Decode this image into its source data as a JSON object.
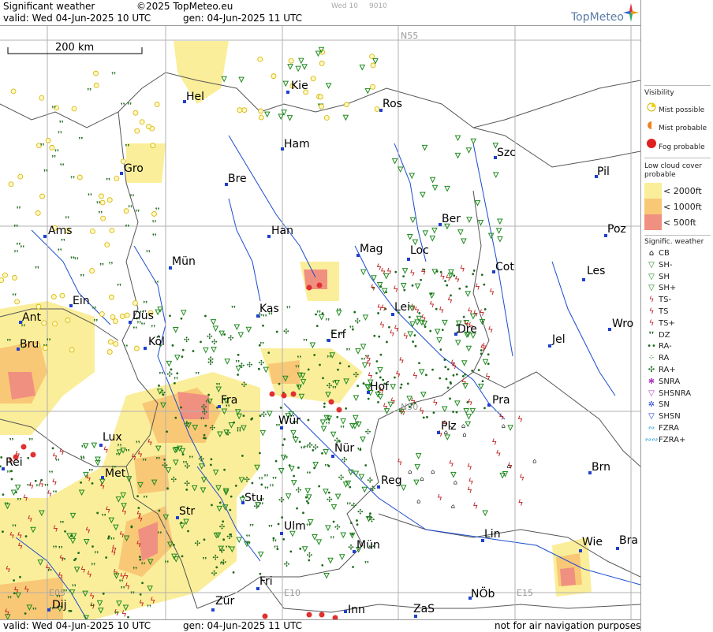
{
  "header": {
    "title": "Significant weather",
    "copyright": "©2025 TopMeteo.eu",
    "valid": "valid:  Wed  04-Jun-2025  10 UTC",
    "gen": "gen: 04-Jun-2025 11 UTC",
    "faint1": "Wed 10",
    "faint2": "9010",
    "logo": "TopMeteo"
  },
  "scale": {
    "label": "200 km"
  },
  "footer": {
    "valid": "valid:  Wed  04-Jun-2025  10 UTC",
    "gen": "gen: 04-Jun-2025 11 UTC",
    "note": "not for air navigation purposes"
  },
  "grid_labels": {
    "n55": "N55",
    "n50": "N50",
    "e05": "E05",
    "e10": "E10",
    "e15": "E15"
  },
  "cities": [
    "Kie",
    "Hel",
    "Ros",
    "Ham",
    "Szc",
    "Gro",
    "Bre",
    "Pil",
    "Ber",
    "Ams",
    "Han",
    "Poz",
    "Mag",
    "Loc",
    "Mün",
    "Cot",
    "Les",
    "Ein",
    "Kas",
    "Lei",
    "Ant",
    "Düs",
    "Wro",
    "Dre",
    "Bru",
    "Köl",
    "Erf",
    "Jel",
    "Hof",
    "Fra",
    "Pra",
    "Lux",
    "Wür",
    "Plz",
    "Rei",
    "Met",
    "Nür",
    "Brn",
    "Reg",
    "Stu",
    "Str",
    "Ulm",
    "Lin",
    "Mün",
    "Wie",
    "Bra",
    "Fri",
    "NÖb",
    "Dij",
    "Zür",
    "Inn",
    "ZaS"
  ],
  "legend": {
    "visibility_title": "Visibility",
    "mist_possible": "Mist possible",
    "mist_probable": "Mist probable",
    "fog_probable": "Fog probable",
    "lowcloud_title": "Low cloud cover probable",
    "lc1": "< 2000ft",
    "lc2": "< 1000ft",
    "lc3": "<   500ft",
    "sigwx_title": "Signific. weather",
    "items": [
      "CB",
      "SH-",
      "SH",
      "SH+",
      "TS-",
      "TS",
      "TS+",
      "DZ",
      "RA-",
      "RA",
      "RA+",
      "SNRA",
      "SHSNRA",
      "SN",
      "SHSN",
      "FZRA",
      "FZRA+"
    ]
  },
  "colors": {
    "cloud_yellow": "#fbee9a",
    "cloud_orange": "#f8c876",
    "cloud_red": "#f09080",
    "shower_green": "#1e8a1e",
    "thunder_red": "#c02020",
    "river_blue": "#1a4bd0"
  }
}
